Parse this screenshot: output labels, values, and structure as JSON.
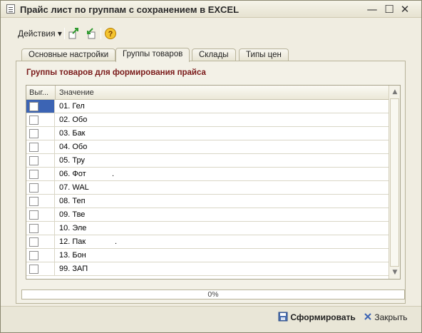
{
  "window": {
    "title": "Прайс лист по группам с сохранением в EXCEL",
    "minimize": "—",
    "maximize": "☐",
    "close": "✕"
  },
  "toolbar": {
    "actions_label": "Действия ▾",
    "icons": [
      "refresh-green-icon",
      "import-icon",
      "help-icon"
    ]
  },
  "tabs": [
    {
      "label": "Основные настройки",
      "active": false
    },
    {
      "label": "Группы товаров",
      "active": true
    },
    {
      "label": "Склады",
      "active": false
    },
    {
      "label": "Типы цен",
      "active": false
    }
  ],
  "section": {
    "title": "Группы товаров для формирования прайса"
  },
  "grid": {
    "columns": [
      "Выг...",
      "Значение"
    ],
    "rows": [
      {
        "checked": false,
        "value": "01. Гел",
        "suffix": ""
      },
      {
        "checked": false,
        "value": "02. Обо",
        "suffix": ""
      },
      {
        "checked": false,
        "value": "03. Бак",
        "suffix": ""
      },
      {
        "checked": false,
        "value": "04. Обо",
        "suffix": ""
      },
      {
        "checked": false,
        "value": "05. Тру",
        "suffix": ""
      },
      {
        "checked": false,
        "value": "06. Фот",
        "suffix": "."
      },
      {
        "checked": false,
        "value": "07. WAL",
        "suffix": ""
      },
      {
        "checked": false,
        "value": "08. Теп",
        "suffix": ""
      },
      {
        "checked": false,
        "value": "09. Тве",
        "suffix": ""
      },
      {
        "checked": false,
        "value": "10. Эле",
        "suffix": ""
      },
      {
        "checked": false,
        "value": "12. Пак",
        "suffix": "."
      },
      {
        "checked": false,
        "value": "13. Бон",
        "suffix": ""
      },
      {
        "checked": false,
        "value": "99. ЗАП",
        "suffix": ""
      }
    ]
  },
  "progress": {
    "value": 0,
    "label": "0%"
  },
  "footer": {
    "form_button": "Сформировать",
    "close_button": "Закрыть"
  },
  "colors": {
    "section_title": "#7a1a1a",
    "selection": "#3c64b4"
  }
}
